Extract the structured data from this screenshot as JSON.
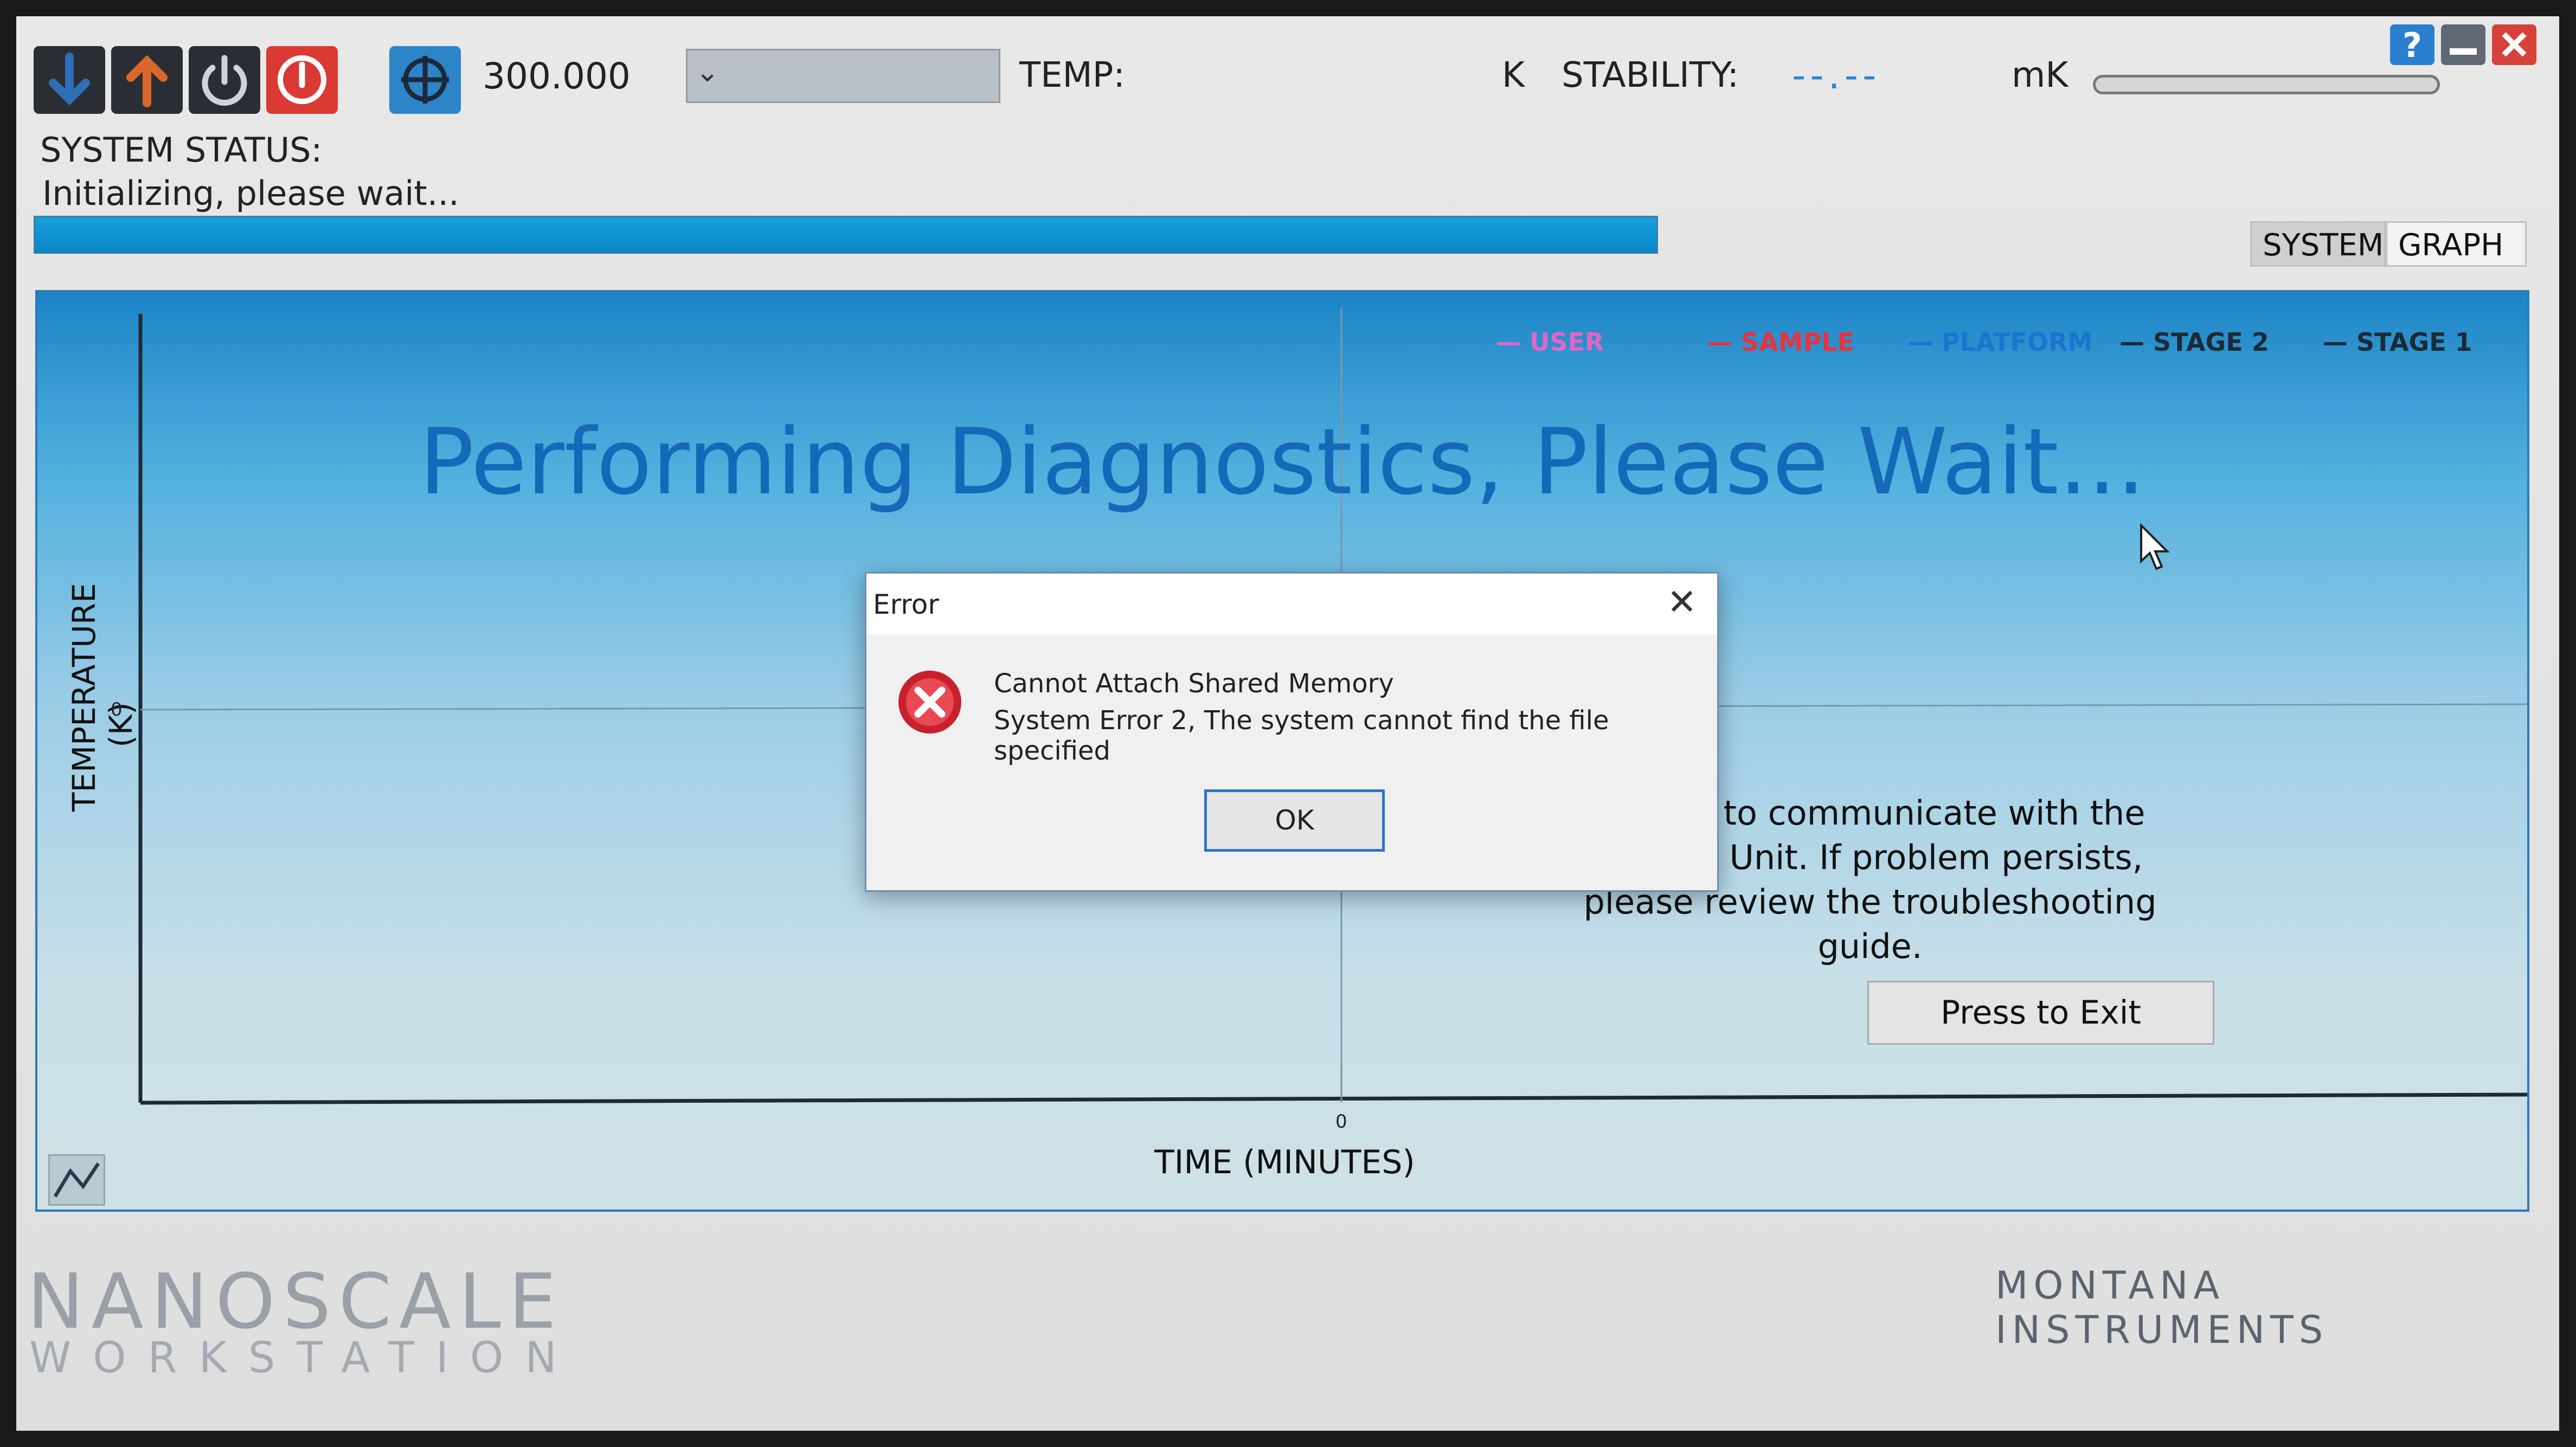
{
  "toolbar": {
    "buttons": [
      {
        "icon": "arrow-down-icon",
        "color": "#2f6fb6"
      },
      {
        "icon": "arrow-up-icon",
        "color": "#d9672a"
      },
      {
        "icon": "power-icon",
        "color": "#2b2b2b"
      },
      {
        "icon": "stop-power-icon",
        "color": "#d93a34"
      },
      {
        "icon": "target-icon",
        "color": "#2d84c7"
      }
    ],
    "setpoint": "300.000",
    "temp_label": "TEMP:",
    "temp_unit": "K",
    "stability_label": "STABILITY:",
    "stability_value": "--.--",
    "stability_unit": "mK"
  },
  "window_controls": [
    "help-icon",
    "minimize-icon",
    "close-icon"
  ],
  "status": {
    "label": "SYSTEM STATUS:",
    "text": "Initializing, please wait...",
    "progress_percent": 100
  },
  "tabs": [
    {
      "label": "SYSTEM",
      "active": false
    },
    {
      "label": "GRAPH",
      "active": true
    }
  ],
  "graph": {
    "legend": [
      {
        "label": "USER",
        "color": "#e066c7"
      },
      {
        "label": "SAMPLE",
        "color": "#e8333f"
      },
      {
        "label": "PLATFORM",
        "color": "#1b74d0"
      },
      {
        "label": "STAGE 2",
        "color": "#1d2a36"
      },
      {
        "label": "STAGE 1",
        "color": "#1d2a36"
      }
    ],
    "overlay_message": "Performing Diagnostics, Please Wait...",
    "y_axis_label": "TEMPERATURE (K)",
    "x_axis_label": "TIME (MINUTES)",
    "y_tick": "0",
    "x_tick": "0",
    "info_line1": "Unable to communicate with the",
    "info_line2": "Control Unit.   If problem persists,",
    "info_line3": "please review the troubleshooting",
    "info_line4": "guide.",
    "exit_button": "Press to Exit"
  },
  "dialog": {
    "title": "Error",
    "message_line1": "Cannot Attach Shared Memory",
    "message_line2": "System Error 2, The system cannot find the file specified",
    "ok_label": "OK",
    "icon": "error-icon"
  },
  "brand": {
    "product_line1": "NANOSCALE",
    "product_line2": "WORKSTATION",
    "company": "MONTANA INSTRUMENTS"
  }
}
